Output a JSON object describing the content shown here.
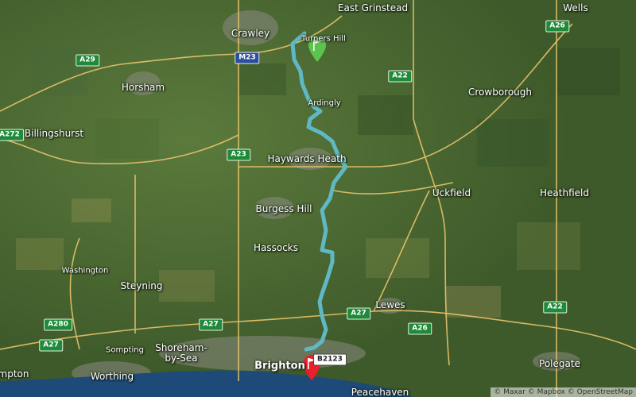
{
  "map": {
    "attribution": "© Maxar © Mapbox © OpenStreetMap",
    "colors": {
      "route": "#5fb8c4",
      "start_flag": "#5cc44c",
      "end_flag": "#e8202a",
      "roads": "#e8c46a",
      "sea": "#1d4a78"
    },
    "places": [
      {
        "id": "east-grinstead",
        "name": "East Grinstead"
      },
      {
        "id": "wells",
        "name": "Wells"
      },
      {
        "id": "crawley",
        "name": "Crawley"
      },
      {
        "id": "turners-hill",
        "name": "Turners Hill"
      },
      {
        "id": "horsham",
        "name": "Horsham"
      },
      {
        "id": "ardingly",
        "name": "Ardingly"
      },
      {
        "id": "crowborough",
        "name": "Crowborough"
      },
      {
        "id": "billingshurst",
        "name": "Billingshurst"
      },
      {
        "id": "haywards-heath",
        "name": "Haywards Heath"
      },
      {
        "id": "uckfield",
        "name": "Uckfield"
      },
      {
        "id": "heathfield",
        "name": "Heathfield"
      },
      {
        "id": "burgess-hill",
        "name": "Burgess Hill"
      },
      {
        "id": "hassocks",
        "name": "Hassocks"
      },
      {
        "id": "washington",
        "name": "Washington"
      },
      {
        "id": "steyning",
        "name": "Steyning"
      },
      {
        "id": "lewes",
        "name": "Lewes"
      },
      {
        "id": "sompting",
        "name": "Sompting"
      },
      {
        "id": "shoreham",
        "name": "Shoreham-\nby-Sea"
      },
      {
        "id": "brighton",
        "name": "Brighton"
      },
      {
        "id": "worthing",
        "name": "Worthing"
      },
      {
        "id": "polegate",
        "name": "Polegate"
      },
      {
        "id": "peacehaven",
        "name": "Peacehaven"
      },
      {
        "id": "rampton",
        "name": "mpton"
      }
    ],
    "road_shields": [
      {
        "id": "a29",
        "label": "A29",
        "style": "green"
      },
      {
        "id": "m23",
        "label": "M23",
        "style": "blue"
      },
      {
        "id": "a26-north",
        "label": "A26",
        "style": "green"
      },
      {
        "id": "a22-north",
        "label": "A22",
        "style": "green"
      },
      {
        "id": "a272",
        "label": "A272",
        "style": "green"
      },
      {
        "id": "a23",
        "label": "A23",
        "style": "green"
      },
      {
        "id": "a27-east",
        "label": "A27",
        "style": "green"
      },
      {
        "id": "a26-south",
        "label": "A26",
        "style": "green"
      },
      {
        "id": "a22-south",
        "label": "A22",
        "style": "green"
      },
      {
        "id": "a280",
        "label": "A280",
        "style": "green"
      },
      {
        "id": "a27-west",
        "label": "A27",
        "style": "green"
      },
      {
        "id": "a27-mid",
        "label": "A27",
        "style": "green"
      },
      {
        "id": "b2123",
        "label": "B2123",
        "style": "white"
      }
    ]
  }
}
